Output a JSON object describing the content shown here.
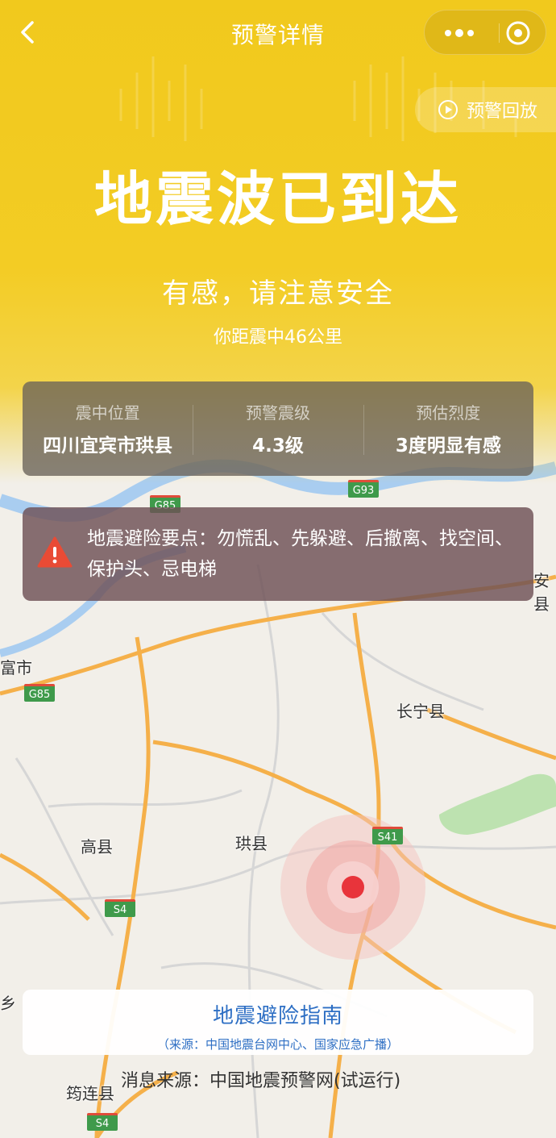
{
  "nav": {
    "title": "预警详情"
  },
  "replay": {
    "label": "预警回放"
  },
  "alert": {
    "headline": "地震波已到达",
    "subtitle": "有感，请注意安全",
    "distance": "你距震中46公里"
  },
  "info": [
    {
      "label": "震中位置",
      "value": "四川宜宾市珙县"
    },
    {
      "label": "预警震级",
      "value": "4.3级"
    },
    {
      "label": "预估烈度",
      "value": "3度明显有感"
    }
  ],
  "tips": {
    "text": "地震避险要点：勿慌乱、先躲避、后撤离、找空间、保护头、忌电梯"
  },
  "guide": {
    "title": "地震避险指南",
    "source": "（来源：中国地震台网中心、国家应急广播）"
  },
  "footer": {
    "source": "消息来源：中国地震预警网(试运行)"
  },
  "map": {
    "places": [
      "长宁县",
      "珙县",
      "高县",
      "筠连县",
      "富市",
      "安县",
      "乡"
    ],
    "roads": [
      "G93",
      "G85",
      "G85",
      "S41",
      "S4",
      "S4"
    ]
  },
  "colors": {
    "hero": "#f1c91d",
    "epicenter": "#e8343b",
    "road_major": "#f5b04a",
    "water": "#a9cdf0",
    "green_area": "#bde2b0",
    "guide_text": "#2e6fc4",
    "warning": "#e94b35"
  },
  "icons": {
    "back": "chevron-left-icon",
    "more": "more-dots-icon",
    "close": "target-icon",
    "replay": "play-circle-icon",
    "warning": "warning-triangle-icon",
    "epicenter": "epicenter-marker-icon"
  }
}
